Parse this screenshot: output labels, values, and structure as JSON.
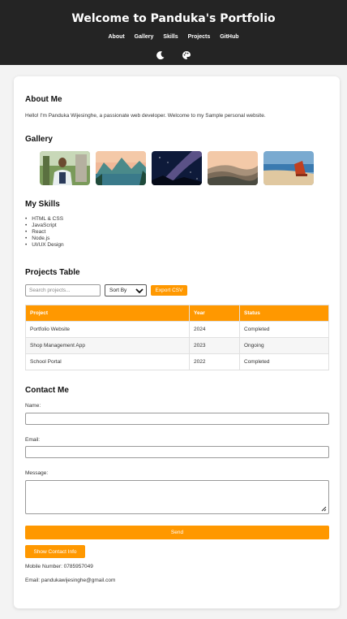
{
  "header": {
    "title": "Welcome to Panduka's Portfolio",
    "nav": [
      "About",
      "Gallery",
      "Skills",
      "Projects",
      "GitHub"
    ],
    "icons": [
      "moon-icon",
      "palette-icon"
    ]
  },
  "about": {
    "title": "About Me",
    "text": "Hello! I'm Panduka Wijesinghe, a passionate web developer. Welcome to my Sample personal website."
  },
  "gallery": {
    "title": "Gallery",
    "images": [
      "portrait-photo",
      "mountain-lake-photo",
      "milky-way-photo",
      "misty-hills-photo",
      "beach-chair-photo"
    ]
  },
  "skills": {
    "title": "My Skills",
    "items": [
      "HTML & CSS",
      "JavaScript",
      "React",
      "Node.js",
      "UI/UX Design"
    ]
  },
  "projects": {
    "title": "Projects Table",
    "search_placeholder": "Search projects...",
    "sort_label": "Sort By",
    "export_label": "Export CSV",
    "columns": [
      "Project",
      "Year",
      "Status"
    ],
    "rows": [
      [
        "Portfolio Website",
        "2024",
        "Completed"
      ],
      [
        "Shop Management App",
        "2023",
        "Ongoing"
      ],
      [
        "School Portal",
        "2022",
        "Completed"
      ]
    ]
  },
  "contact": {
    "title": "Contact Me",
    "name_label": "Name:",
    "email_label": "Email:",
    "message_label": "Message:",
    "send_label": "Send",
    "show_info_label": "Show Contact Info",
    "mobile": "Mobile Number: 0785957049",
    "email_info": "Email: pandukawijesinghe@gmail.com"
  },
  "colors": {
    "accent": "#ff9800",
    "header_bg": "#242424",
    "page_bg": "#f3f3f3"
  }
}
